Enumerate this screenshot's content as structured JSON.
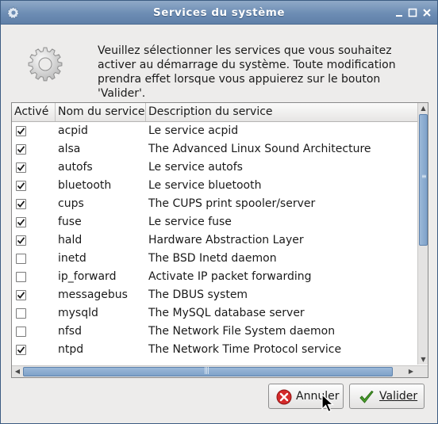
{
  "window": {
    "title": "Services du système"
  },
  "header": {
    "description": "Veuillez sélectionner les services que vous souhaitez activer au démarrage du système. Toute modification prendra effet lorsque vous appuierez sur le bouton 'Valider'.",
    "icon": "gear-icon"
  },
  "table": {
    "columns": [
      "Activé",
      "Nom du service",
      "Description du service"
    ],
    "rows": [
      {
        "enabled": true,
        "name": "acpid",
        "description": "Le service acpid"
      },
      {
        "enabled": true,
        "name": "alsa",
        "description": "The Advanced Linux Sound Architecture"
      },
      {
        "enabled": true,
        "name": "autofs",
        "description": "Le service autofs"
      },
      {
        "enabled": true,
        "name": "bluetooth",
        "description": "Le service bluetooth"
      },
      {
        "enabled": true,
        "name": "cups",
        "description": "The CUPS print spooler/server"
      },
      {
        "enabled": true,
        "name": "fuse",
        "description": "Le service fuse"
      },
      {
        "enabled": true,
        "name": "hald",
        "description": "Hardware Abstraction Layer"
      },
      {
        "enabled": false,
        "name": "inetd",
        "description": "The BSD Inetd daemon"
      },
      {
        "enabled": false,
        "name": "ip_forward",
        "description": "Activate IP packet forwarding"
      },
      {
        "enabled": true,
        "name": "messagebus",
        "description": "The DBUS system"
      },
      {
        "enabled": false,
        "name": "mysqld",
        "description": "The MySQL database server"
      },
      {
        "enabled": false,
        "name": "nfsd",
        "description": "The Network File System daemon"
      },
      {
        "enabled": true,
        "name": "ntpd",
        "description": "The Network Time Protocol service"
      }
    ]
  },
  "buttons": {
    "cancel": {
      "label": "Annuler",
      "icon": "cancel-icon"
    },
    "apply": {
      "label": "Valider",
      "icon": "checkmark-icon"
    }
  },
  "colors": {
    "titlebar": "#6d8db4",
    "scroll_thumb": "#8fb0d4",
    "cancel_red": "#d42a2a",
    "check_green": "#4aa02c"
  }
}
